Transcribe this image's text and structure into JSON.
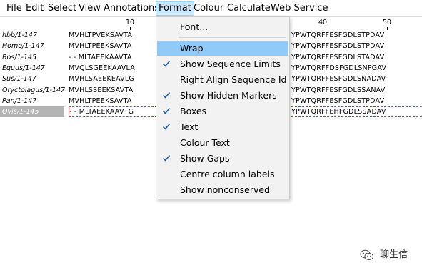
{
  "menubar": {
    "items": [
      {
        "label": "File"
      },
      {
        "label": "Edit"
      },
      {
        "label": "Select"
      },
      {
        "label": "View"
      },
      {
        "label": "Annotations"
      },
      {
        "label": "Format"
      },
      {
        "label": "Colour"
      },
      {
        "label": "Calculate"
      },
      {
        "label": "Web Service"
      }
    ]
  },
  "ruler": {
    "labels": [
      "10",
      "40",
      "50"
    ]
  },
  "alignment": {
    "rows": [
      {
        "id": "hbb/1-147",
        "left": "MVHLTPVEKSAVTA",
        "right": "YPWTQRFFESFGDLSTPDAV"
      },
      {
        "id": "Homo/1-147",
        "left": "MVHLTPEEKSAVTA",
        "right": "YPWTQRFFESFGDLSTPDAV"
      },
      {
        "id": "Bos/1-145",
        "left": "- - MLTAEEKAAVTA",
        "right": "YPWTQRFFESFGDLSTADAV"
      },
      {
        "id": "Equus/1-147",
        "left": "MVQLSGEEKAAVLA",
        "right": "YPWTQRFFDSFGDLSNPGAV"
      },
      {
        "id": "Sus/1-147",
        "left": "MVHLSAEEKEAVLG",
        "right": "YPWTQRFFESFGDLSNADAV"
      },
      {
        "id": "Oryctolagus/1-147",
        "left": "MVHLSSEEKSAVTA",
        "right": "YPWTQRFFESFGDLSSANAV"
      },
      {
        "id": "Pan/1-147",
        "left": "MVHLTPEEKSAVTA",
        "right": "YPWTQRFFESFGDLSTPDAV"
      },
      {
        "id": "Ovis/1-145",
        "left": "- - MLTAEEKAAVTG",
        "right": "YPWTQRFFEHFGDLSSADAV"
      }
    ]
  },
  "format_menu": {
    "items": [
      {
        "label": "Font...",
        "checked": false,
        "highlighted": false
      },
      {
        "label": "Wrap",
        "checked": false,
        "highlighted": true
      },
      {
        "label": "Show Sequence Limits",
        "checked": true,
        "highlighted": false
      },
      {
        "label": "Right Align Sequence Id",
        "checked": false,
        "highlighted": false
      },
      {
        "label": "Show Hidden Markers",
        "checked": true,
        "highlighted": false
      },
      {
        "label": "Boxes",
        "checked": true,
        "highlighted": false
      },
      {
        "label": "Text",
        "checked": true,
        "highlighted": false
      },
      {
        "label": "Colour Text",
        "checked": false,
        "highlighted": false
      },
      {
        "label": "Show Gaps",
        "checked": true,
        "highlighted": false
      },
      {
        "label": "Centre column labels",
        "checked": false,
        "highlighted": false
      },
      {
        "label": "Show nonconserved",
        "checked": false,
        "highlighted": false
      }
    ]
  },
  "watermark": {
    "text": "聊生信",
    "icon": "wechat-icon"
  },
  "colors": {
    "menu_highlight": "#91c9f7",
    "active_menu": "#cce8ff",
    "selection_border": "#e0303a",
    "selected_id_bg": "#b4b4b4"
  }
}
